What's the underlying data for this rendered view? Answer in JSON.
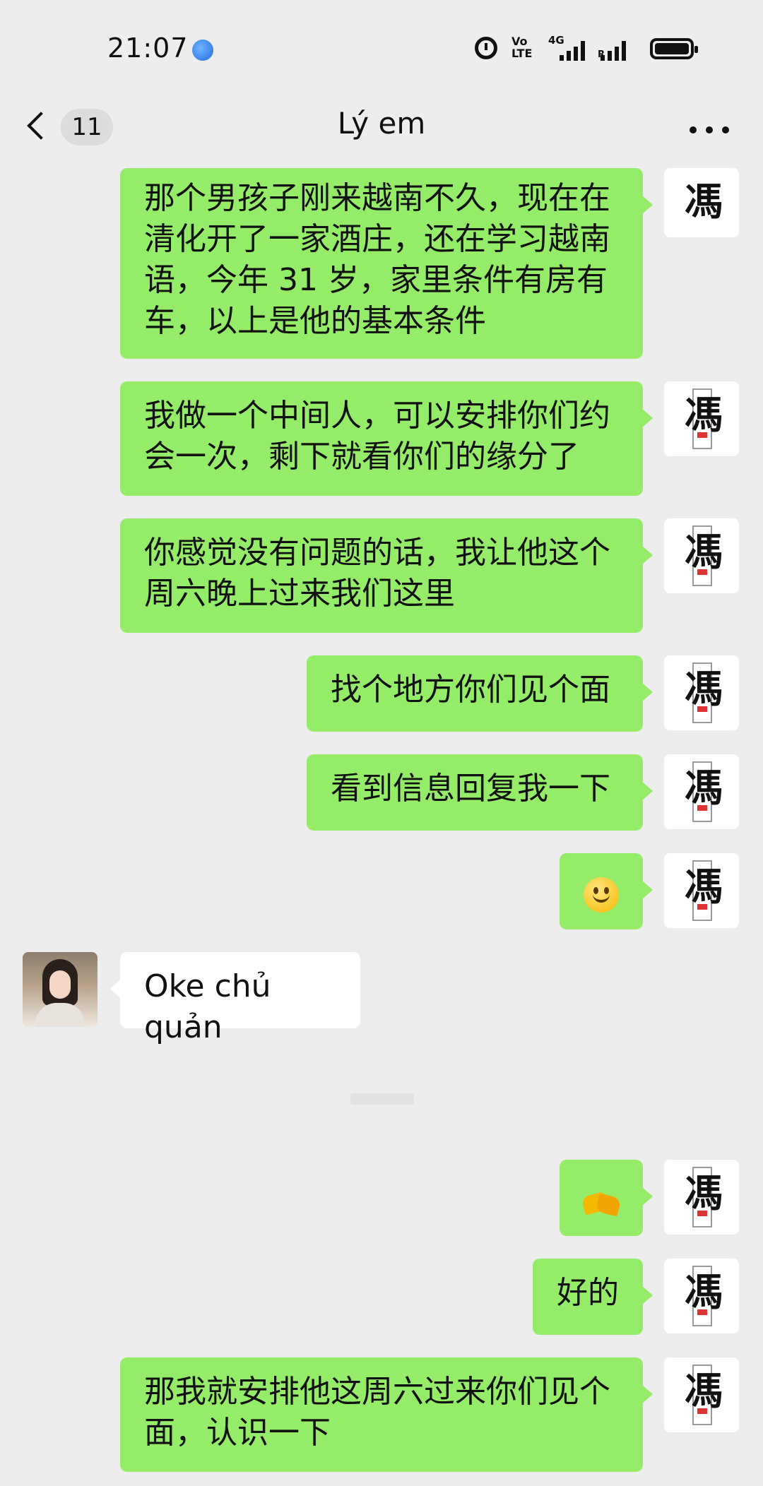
{
  "status_bar": {
    "time": "21:07",
    "volte": "Vo\nLTE",
    "network": "4G",
    "roaming": "R"
  },
  "header": {
    "back_badge": "11",
    "title": "Lý em",
    "more_icon": "more-horizontal-icon"
  },
  "messages": [
    {
      "side": "self",
      "type": "text",
      "text": "那个男孩子刚来越南不久，现在在清化开了一家酒庄，还在学习越南语，今年 31 岁，家里条件有房有车，以上是他的基本条件"
    },
    {
      "side": "self",
      "type": "text",
      "text": "我做一个中间人，可以安排你们约会一次，剩下就看你们的缘分了"
    },
    {
      "side": "self",
      "type": "text",
      "text": "你感觉没有问题的话，我让他这个周六晚上过来我们这里"
    },
    {
      "side": "self",
      "type": "text",
      "text": "找个地方你们见个面"
    },
    {
      "side": "self",
      "type": "text",
      "text": "看到信息回复我一下"
    },
    {
      "side": "self",
      "type": "emoji",
      "emoji": "smile-emoji"
    },
    {
      "side": "other",
      "type": "text",
      "text": "Oke chủ quản"
    },
    {
      "side": "self",
      "type": "emoji",
      "emoji": "handshake-emoji"
    },
    {
      "side": "self",
      "type": "text",
      "text": "好的"
    },
    {
      "side": "self",
      "type": "text",
      "text": "那我就安排他这周六过来你们见个面，认识一下"
    }
  ],
  "self_avatar_glyph": "馮"
}
